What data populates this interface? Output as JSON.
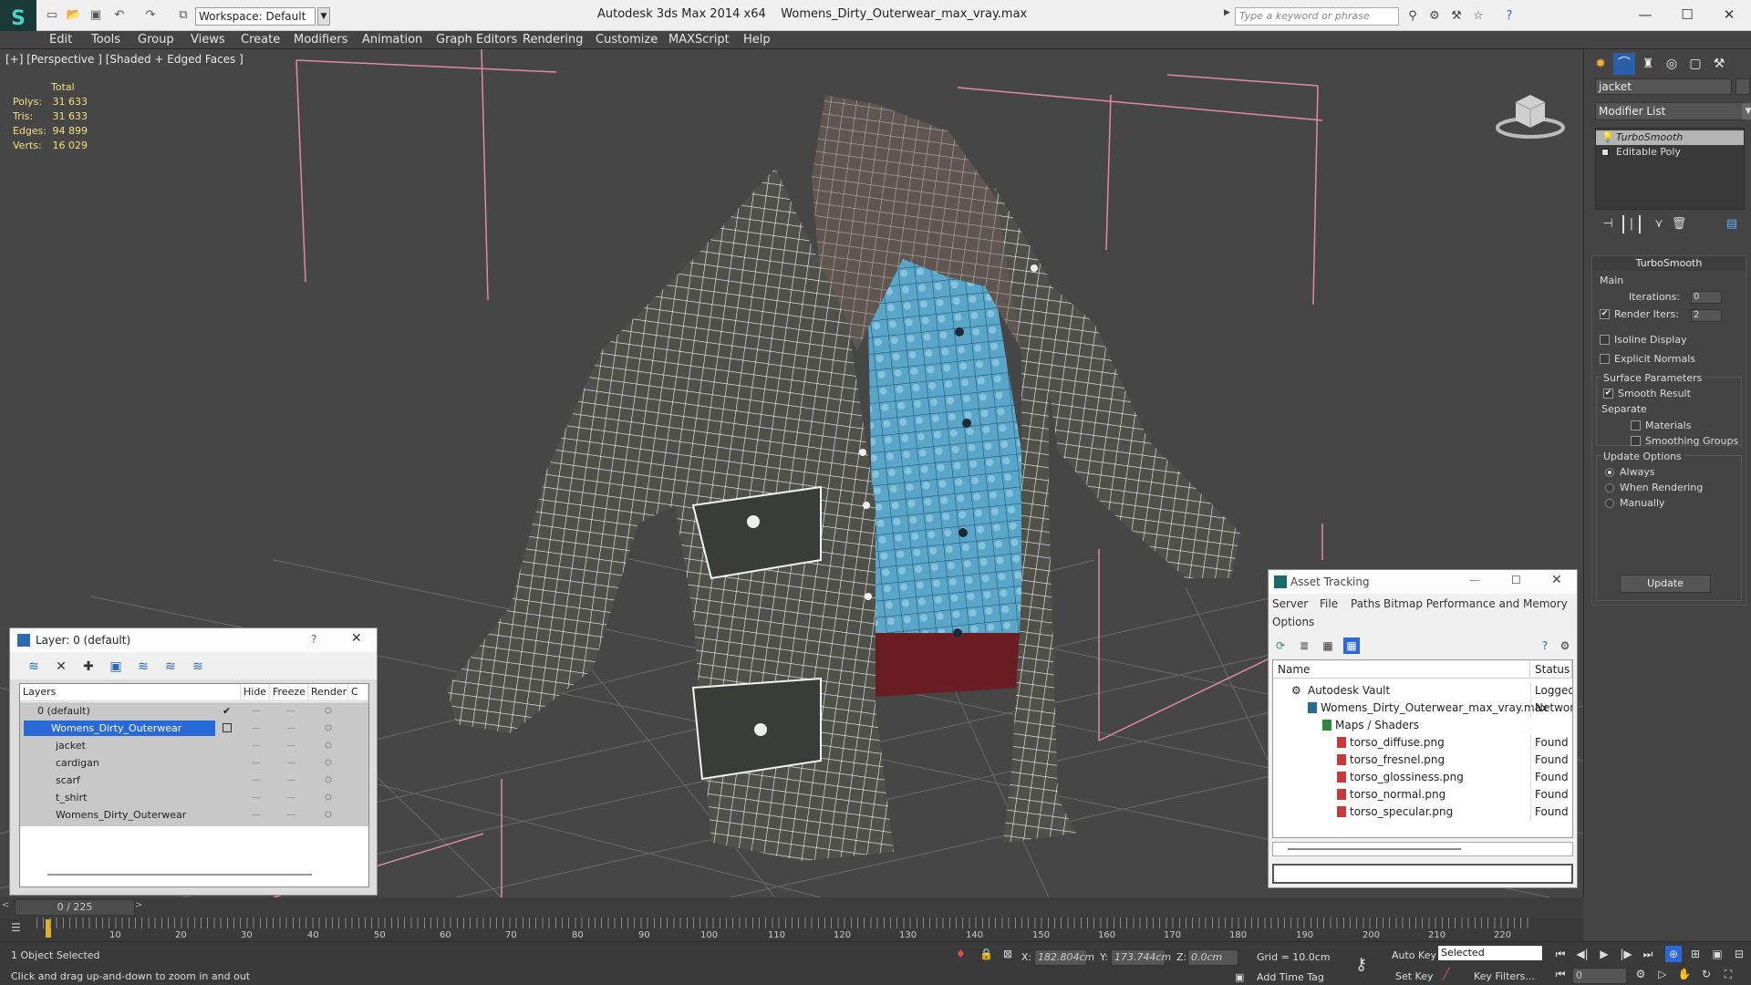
{
  "app": {
    "title": "Autodesk 3ds Max  2014 x64",
    "filename": "Womens_Dirty_Outerwear_max_vray.max",
    "workspace": "Workspace: Default",
    "search_placeholder": "Type a keyword or phrase"
  },
  "menu": [
    "Edit",
    "Tools",
    "Group",
    "Views",
    "Create",
    "Modifiers",
    "Animation",
    "Graph Editors",
    "Rendering",
    "Customize",
    "MAXScript",
    "Help"
  ],
  "viewport": {
    "label": "[+] [Perspective ] [Shaded + Edged Faces ]",
    "stats_header": "Total",
    "stats": [
      {
        "label": "Polys:",
        "value": "31 633"
      },
      {
        "label": "Tris:",
        "value": "31 633"
      },
      {
        "label": "Edges:",
        "value": "94 899"
      },
      {
        "label": "Verts:",
        "value": "16 029"
      }
    ]
  },
  "command_panel": {
    "object_name": "jacket",
    "modifier_list": "Modifier List",
    "stack": [
      "TurboSmooth",
      "Editable Poly"
    ],
    "turbosmooth": {
      "title": "TurboSmooth",
      "main": "Main",
      "iterations_label": "Iterations:",
      "iterations": "0",
      "render_iters_label": "Render Iters:",
      "render_iters": "2",
      "isoline": "Isoline Display",
      "explicit": "Explicit Normals",
      "surface_params": "Surface Parameters",
      "smooth_result": "Smooth Result",
      "separate": "Separate",
      "materials": "Materials",
      "smoothing_groups": "Smoothing Groups",
      "update_options": "Update Options",
      "always": "Always",
      "when_rendering": "When Rendering",
      "manually": "Manually",
      "update": "Update"
    }
  },
  "layer_window": {
    "title": "Layer: 0 (default)",
    "help": "?",
    "columns": [
      "Layers",
      "Hide",
      "Freeze",
      "Render",
      "C"
    ],
    "rows": [
      {
        "name": "0 (default)",
        "indent": 1,
        "selected": false
      },
      {
        "name": "Womens_Dirty_Outerwear",
        "indent": 1,
        "selected": true
      },
      {
        "name": "jacket",
        "indent": 2,
        "selected": false
      },
      {
        "name": "cardigan",
        "indent": 2,
        "selected": false
      },
      {
        "name": "scarf",
        "indent": 2,
        "selected": false
      },
      {
        "name": "t_shirt",
        "indent": 2,
        "selected": false
      },
      {
        "name": "Womens_Dirty_Outerwear",
        "indent": 2,
        "selected": false
      }
    ]
  },
  "asset_window": {
    "title": "Asset Tracking",
    "menu": [
      "Server",
      "File",
      "Paths",
      "Bitmap Performance and Memory"
    ],
    "menu2": "Options",
    "columns": [
      "Name",
      "Status"
    ],
    "rows": [
      {
        "name": "Autodesk Vault",
        "status": "Logged O",
        "indent": 1
      },
      {
        "name": "Womens_Dirty_Outerwear_max_vray.max",
        "status": "Network",
        "indent": 2
      },
      {
        "name": "Maps / Shaders",
        "status": "",
        "indent": 3
      },
      {
        "name": "torso_diffuse.png",
        "status": "Found",
        "indent": 4
      },
      {
        "name": "torso_fresnel.png",
        "status": "Found",
        "indent": 4
      },
      {
        "name": "torso_glossiness.png",
        "status": "Found",
        "indent": 4
      },
      {
        "name": "torso_normal.png",
        "status": "Found",
        "indent": 4
      },
      {
        "name": "torso_specular.png",
        "status": "Found",
        "indent": 4
      }
    ]
  },
  "timeline": {
    "frame": "0 / 225",
    "ticks": [
      "10",
      "20",
      "30",
      "40",
      "50",
      "60",
      "70",
      "80",
      "90",
      "100",
      "110",
      "120",
      "130",
      "140",
      "150",
      "160",
      "170",
      "180",
      "190",
      "200",
      "210",
      "220"
    ]
  },
  "status": {
    "selected": "1 Object Selected",
    "hint": "Click and drag up-and-down to zoom in and out",
    "x_label": "X:",
    "x": "182.804cm",
    "y_label": "Y:",
    "y": "173.744cm",
    "z_label": "Z:",
    "z": "0.0cm",
    "grid": "Grid = 10.0cm",
    "add_time_tag": "Add Time Tag",
    "auto_key": "Auto Key",
    "set_key": "Set Key",
    "selected_dd": "Selected",
    "key_filters": "Key Filters...",
    "frame_field": "0"
  }
}
